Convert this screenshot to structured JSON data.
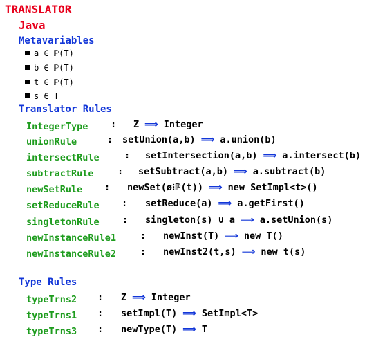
{
  "title": "TRANSLATOR",
  "language": "Java",
  "metavariables": {
    "heading": "Metavariables",
    "items": [
      "a ∈ ℙ(T)",
      "b ∈ ℙ(T)",
      "t ∈ ℙ(T)",
      "s ∈ T"
    ]
  },
  "translator_rules": {
    "heading": "Translator Rules",
    "rules": [
      {
        "name": "IntegerType",
        "lhs": "Z",
        "rhs": "Integer"
      },
      {
        "name": "unionRule",
        "lhs": "setUnion(a,b)",
        "rhs": "a.union(b)"
      },
      {
        "name": "intersectRule",
        "lhs": "setIntersection(a,b)",
        "rhs": "a.intersect(b)"
      },
      {
        "name": "subtractRule",
        "lhs": "setSubtract(a,b)",
        "rhs": "a.subtract(b)"
      },
      {
        "name": "newSetRule",
        "lhs": "newSet(ø⁝ℙ(t))",
        "rhs": "new SetImpl<t>()"
      },
      {
        "name": "setReduceRule",
        "lhs": "setReduce(a)",
        "rhs": "a.getFirst()"
      },
      {
        "name": "singletonRule",
        "lhs": "singleton(s) ∪ a",
        "rhs": "a.setUnion(s)"
      },
      {
        "name": "newInstanceRule1",
        "lhs": "newInst(T)",
        "rhs": "new T()"
      },
      {
        "name": "newInstanceRule2",
        "lhs": "newInst2(t,s)",
        "rhs": "new t(s)"
      }
    ]
  },
  "type_rules": {
    "heading": "Type Rules",
    "rules": [
      {
        "name": "typeTrns2",
        "lhs": "Z",
        "rhs": "Integer"
      },
      {
        "name": "typeTrns1",
        "lhs": "setImpl(T)",
        "rhs": "SetImpl<T>"
      },
      {
        "name": "typeTrns3",
        "lhs": "newType(T)",
        "rhs": "T"
      }
    ]
  },
  "separator": ":",
  "arrow_symbol": "⟹"
}
